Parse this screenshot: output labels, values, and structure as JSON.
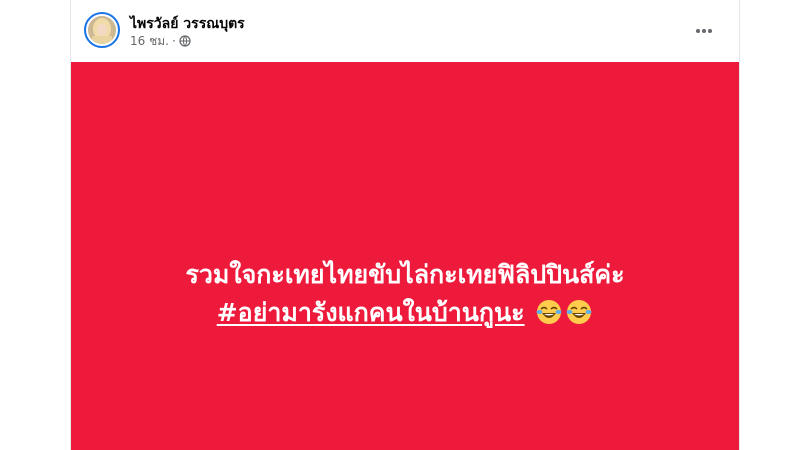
{
  "post": {
    "author_name": "ไพรวัลย์ วรรณบุตร",
    "timestamp": "16 ชม.",
    "separator": "·",
    "privacy_icon": "globe-icon",
    "more_icon": "more-horizontal-icon",
    "text_line1": "รวมใจกะเทยไทยขับไล่กะเทยฟิลิปปินส์ค่ะ",
    "hashtag": "#อย่ามารังแกคนในบ้านกูนะ",
    "emojis": [
      "face-with-tears-of-joy-icon",
      "face-with-tears-of-joy-icon"
    ]
  },
  "colors": {
    "background_color": "#ED1A3B",
    "text_color": "#FFFFFF",
    "avatar_ring": "#1B74E4"
  }
}
